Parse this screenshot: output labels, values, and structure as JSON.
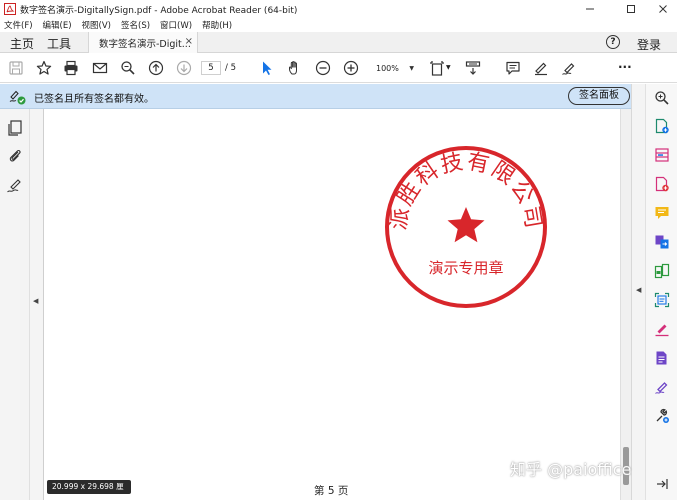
{
  "window": {
    "title": "数字签名演示-DigitallySign.pdf - Adobe Acrobat Reader (64-bit)",
    "controls": [
      "minimize-icon",
      "maximize-icon",
      "close-icon"
    ]
  },
  "menu": [
    "文件(F)",
    "编辑(E)",
    "视图(V)",
    "签名(S)",
    "窗口(W)",
    "帮助(H)"
  ],
  "tabs": {
    "home": "主页",
    "tools": "工具",
    "document": "数字签名演示-Digit...",
    "close_glyph": "×",
    "help": "?",
    "login": "登录"
  },
  "toolbar": {
    "current_page": "5",
    "page_count": "/ 5",
    "zoom": "100%",
    "more": "···"
  },
  "signature_bar": {
    "message": "已签名且所有签名都有效。",
    "panel_button": "签名面板"
  },
  "stamp": {
    "company": "派胜科技有限公司",
    "purpose": "演示专用章",
    "color": "#d8262b"
  },
  "document": {
    "page_caption": "第 5 页",
    "page_size": "20.999 x 29.698 厘米"
  },
  "watermark": "知乎 @paioffice",
  "accent": "#1473e6"
}
